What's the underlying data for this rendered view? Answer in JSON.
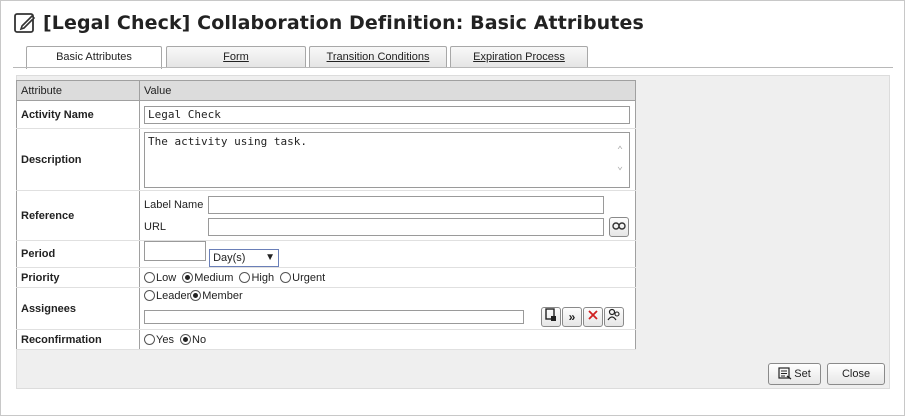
{
  "title": "[Legal Check] Collaboration Definition: Basic Attributes",
  "tabs": [
    {
      "label": "Basic Attributes"
    },
    {
      "label": "Form"
    },
    {
      "label": "Transition Conditions"
    },
    {
      "label": "Expiration Process"
    }
  ],
  "table": {
    "header_attribute": "Attribute",
    "header_value": "Value",
    "activity_name_label": "Activity Name",
    "activity_name_value": "Legal Check",
    "description_label": "Description",
    "description_value": "The activity using task.",
    "reference_label": "Reference",
    "label_name_label": "Label Name",
    "label_name_value": "",
    "url_label": "URL",
    "url_value": "",
    "period_label": "Period",
    "period_value": "",
    "period_unit": "Day(s)",
    "priority_label": "Priority",
    "priority_options": [
      "Low",
      "Medium",
      "High",
      "Urgent"
    ],
    "priority_selected": "Medium",
    "assignees_label": "Assignees",
    "assignee_options": [
      "Leader",
      "Member"
    ],
    "assignee_selected": "Member",
    "reconfirmation_label": "Reconfirmation",
    "reconfirmation_options": [
      "Yes",
      "No"
    ],
    "reconfirmation_selected": "No"
  },
  "buttons": {
    "set": "Set",
    "close": "Close"
  },
  "icons": {
    "title": "edit-icon",
    "link": "link-icon",
    "assign_user": "user-select-icon",
    "forward": "forward-icon",
    "delete": "delete-icon",
    "group": "group-icon",
    "set": "set-icon"
  }
}
